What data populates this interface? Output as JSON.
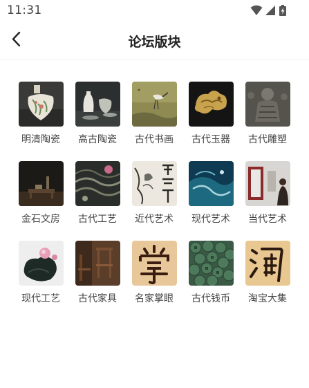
{
  "status": {
    "time": "11:31"
  },
  "header": {
    "title": "论坛版块"
  },
  "forums": [
    {
      "label": "明清陶瓷",
      "icon": "ming-qing-porcelain-vase"
    },
    {
      "label": "高古陶瓷",
      "icon": "ancient-ceramic-vases"
    },
    {
      "label": "古代书画",
      "icon": "ancient-painting-crane"
    },
    {
      "label": "古代玉器",
      "icon": "ancient-jade-dragon"
    },
    {
      "label": "古代雕塑",
      "icon": "ancient-stone-sculpture"
    },
    {
      "label": "金石文房",
      "icon": "scholar-desk-objects"
    },
    {
      "label": "古代工艺",
      "icon": "ancient-lacquer-craft"
    },
    {
      "label": "近代艺术",
      "icon": "modern-ink-painting"
    },
    {
      "label": "现代艺术",
      "icon": "contemporary-abstract-painting"
    },
    {
      "label": "当代艺术",
      "icon": "contemporary-art-gallery"
    },
    {
      "label": "现代工艺",
      "icon": "modern-craft-sculpture"
    },
    {
      "label": "古代家具",
      "icon": "antique-furniture"
    },
    {
      "label": "名家掌眼",
      "icon": "calligraphy-zhang-character"
    },
    {
      "label": "古代钱币",
      "icon": "ancient-coins"
    },
    {
      "label": "淘宝大集",
      "icon": "calligraphy-tao-character"
    }
  ]
}
